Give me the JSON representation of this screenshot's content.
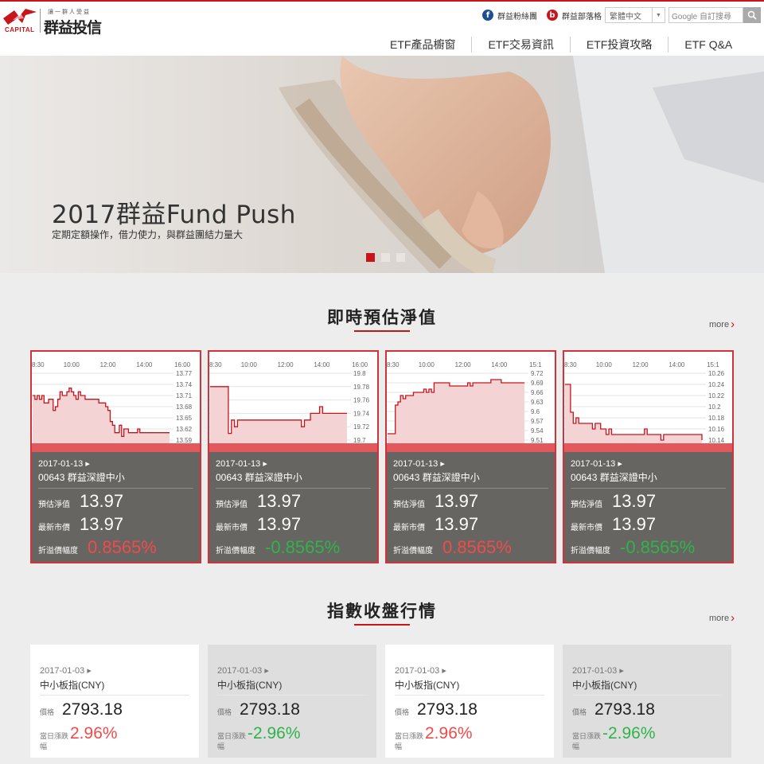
{
  "header": {
    "logo_text": "CAPITAL",
    "logo_slogan": "讓一群人受益",
    "logo_name": "群益投信",
    "fb_label": "群益粉絲團",
    "blog_label": "群益部落格",
    "language": "繁體中文",
    "search_placeholder": "Google 自訂搜尋",
    "nav": [
      "ETF產品櫥窗",
      "ETF交易資訊",
      "ETF投資攻略",
      "ETF Q&A"
    ]
  },
  "hero": {
    "title": "2017群益Fund Push",
    "subtitle": "定期定額操作，借力使力，與群益團結力量大",
    "slides": 3,
    "active_slide": 1
  },
  "nav_section": {
    "title": "即時預估淨值",
    "more_label": "more"
  },
  "cards": [
    {
      "date": "2017-01-13",
      "name": "00643 群益深證中小",
      "est_label": "預估淨值",
      "est_value": "13.97",
      "mkt_label": "最新市價",
      "mkt_value": "13.97",
      "prem_label": "折溢價幅度",
      "prem_value": "0.8565%",
      "prem_color": "#f04b4b",
      "chart_data": {
        "type": "line",
        "x_ticks": [
          "8:30",
          "10:00",
          "12:00",
          "14:00",
          "16:00"
        ],
        "y_ticks": [
          "13.77",
          "13.74",
          "13.71",
          "13.68",
          "13.65",
          "13.62",
          "13.59"
        ],
        "ylim": [
          13.59,
          13.77
        ],
        "values": [
          13.71,
          13.7,
          13.71,
          13.7,
          13.71,
          13.69,
          13.69,
          13.7,
          13.7,
          13.67,
          13.68,
          13.7,
          13.72,
          13.71,
          13.71,
          13.72,
          13.73,
          13.72,
          13.71,
          13.7,
          13.72,
          13.71,
          13.71,
          13.7,
          13.7,
          13.7,
          13.7,
          13.7,
          13.7,
          13.69,
          13.69,
          13.69,
          13.68,
          13.67,
          13.64,
          13.63,
          13.61,
          13.61,
          13.63,
          13.6,
          13.62,
          13.62,
          13.61,
          13.61,
          13.61,
          13.61,
          13.62,
          13.61,
          13.61,
          13.61,
          13.61,
          13.61,
          13.61,
          13.61,
          13.61,
          13.61,
          13.61,
          13.61,
          13.61,
          13.61,
          13.61
        ]
      }
    },
    {
      "date": "2017-01-13",
      "name": "00643 群益深證中小",
      "est_label": "預估淨值",
      "est_value": "13.97",
      "mkt_label": "最新市價",
      "mkt_value": "13.97",
      "prem_label": "折溢價幅度",
      "prem_value": "-0.8565%",
      "prem_color": "#2fb34a",
      "chart_data": {
        "type": "line",
        "x_ticks": [
          "8:30",
          "10:00",
          "12:00",
          "14:00",
          "16:00"
        ],
        "y_ticks": [
          "19.8",
          "19.78",
          "19.76",
          "19.74",
          "19.72",
          "19.7"
        ],
        "ylim": [
          19.7,
          19.8
        ],
        "values": [
          19.78,
          19.78,
          19.78,
          19.78,
          19.78,
          19.78,
          19.71,
          19.73,
          19.72,
          19.73,
          19.73,
          19.73,
          19.73,
          19.73,
          19.73,
          19.73,
          19.73,
          19.73,
          19.73,
          19.73,
          19.73,
          19.73,
          19.73,
          19.73,
          19.73,
          19.73,
          19.73,
          19.73,
          19.73,
          19.73,
          19.72,
          19.73,
          19.73,
          19.74,
          19.74,
          19.74,
          19.75,
          19.74,
          19.74,
          19.74,
          19.74,
          19.74,
          19.74,
          19.74,
          19.74,
          19.74
        ]
      }
    },
    {
      "date": "2017-01-13",
      "name": "00643 群益深證中小",
      "est_label": "預估淨值",
      "est_value": "13.97",
      "mkt_label": "最新市價",
      "mkt_value": "13.97",
      "prem_label": "折溢價幅度",
      "prem_value": "0.8565%",
      "prem_color": "#f04b4b",
      "chart_data": {
        "type": "line",
        "x_ticks": [
          "8:30",
          "10:00",
          "12:00",
          "14:00",
          "15:1"
        ],
        "y_ticks": [
          "9.72",
          "9.69",
          "9.66",
          "9.63",
          "9.6",
          "9.57",
          "9.54",
          "9.51"
        ],
        "ylim": [
          9.51,
          9.72
        ],
        "values": [
          9.53,
          9.53,
          9.53,
          9.62,
          9.63,
          9.65,
          9.64,
          9.65,
          9.65,
          9.65,
          9.66,
          9.66,
          9.66,
          9.66,
          9.67,
          9.66,
          9.67,
          9.66,
          9.69,
          9.69,
          9.69,
          9.69,
          9.69,
          9.69,
          9.68,
          9.68,
          9.68,
          9.68,
          9.68,
          9.68,
          9.68,
          9.69,
          9.68,
          9.69,
          9.69,
          9.69,
          9.69,
          9.69,
          9.69,
          9.69,
          9.7,
          9.7,
          9.7,
          9.7,
          9.69,
          9.69,
          9.69,
          9.69,
          9.69,
          9.69,
          9.69,
          9.69,
          9.69,
          9.69
        ]
      }
    },
    {
      "date": "2017-01-13",
      "name": "00643 群益深證中小",
      "est_label": "預估淨值",
      "est_value": "13.97",
      "mkt_label": "最新市價",
      "mkt_value": "13.97",
      "prem_label": "折溢價幅度",
      "prem_value": "-0.8565%",
      "prem_color": "#2fb34a",
      "chart_data": {
        "type": "line",
        "x_ticks": [
          "8:30",
          "10:00",
          "12:00",
          "14:00",
          "15:1"
        ],
        "y_ticks": [
          "10.26",
          "10.24",
          "10.22",
          "10.2",
          "10.18",
          "10.16",
          "10.14"
        ],
        "ylim": [
          10.14,
          10.26
        ],
        "values": [
          10.24,
          10.24,
          10.19,
          10.17,
          10.18,
          10.17,
          10.17,
          10.17,
          10.17,
          10.17,
          10.16,
          10.17,
          10.17,
          10.16,
          10.16,
          10.15,
          10.16,
          10.15,
          10.15,
          10.15,
          10.15,
          10.15,
          10.15,
          10.15,
          10.15,
          10.15,
          10.15,
          10.15,
          10.15,
          10.16,
          10.15,
          10.15,
          10.15,
          10.15,
          10.15,
          10.14,
          10.15,
          10.15,
          10.15,
          10.15,
          10.15,
          10.15,
          10.15,
          10.15,
          10.15,
          10.15,
          10.15,
          10.15,
          10.15,
          10.15,
          10.14
        ]
      }
    }
  ],
  "index_section": {
    "title": "指數收盤行情",
    "more_label": "more"
  },
  "index_cards": [
    {
      "date": "2017-01-03",
      "name": "中小板指(CNY)",
      "price_label": "價格",
      "price": "2793.18",
      "chg_label": "當日漲跌幅",
      "chg": "2.96%",
      "chg_color": "#f04b4b",
      "bg": "#ffffff"
    },
    {
      "date": "2017-01-03",
      "name": "中小板指(CNY)",
      "price_label": "價格",
      "price": "2793.18",
      "chg_label": "當日漲跌幅",
      "chg": "-2.96%",
      "chg_color": "#2fb34a",
      "bg": "#dedede"
    },
    {
      "date": "2017-01-03",
      "name": "中小板指(CNY)",
      "price_label": "價格",
      "price": "2793.18",
      "chg_label": "當日漲跌幅",
      "chg": "2.96%",
      "chg_color": "#f04b4b",
      "bg": "#ffffff"
    },
    {
      "date": "2017-01-03",
      "name": "中小板指(CNY)",
      "price_label": "價格",
      "price": "2793.18",
      "chg_label": "當日漲跌幅",
      "chg": "-2.96%",
      "chg_color": "#2fb34a",
      "bg": "#dedede"
    }
  ]
}
